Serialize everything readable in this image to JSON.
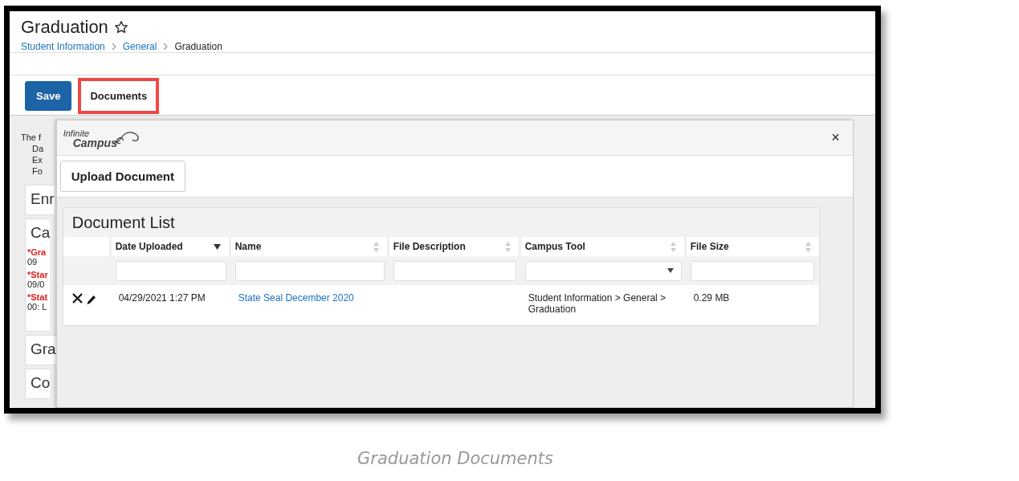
{
  "screenshot": {
    "page_header": {
      "title": "Graduation",
      "favorite": false,
      "breadcrumbs": [
        {
          "label": "Student Information",
          "link": true
        },
        {
          "label": "General",
          "link": true
        },
        {
          "label": "Graduation",
          "link": false
        }
      ]
    },
    "toolbar": [
      {
        "label": "Save",
        "kind": "primary",
        "highlighted": false
      },
      {
        "label": "Documents",
        "kind": "secondary",
        "highlighted": true
      }
    ],
    "background": {
      "intro": [
        "The f",
        "Da",
        "Ex",
        "Fo"
      ],
      "sections": [
        {
          "title": "Enr"
        },
        {
          "title": "Ca",
          "fields": [
            {
              "label": "*Gra",
              "value": "09"
            },
            {
              "label": "*Star",
              "value": "09/0"
            },
            {
              "label": "*Stat",
              "value": "00: L"
            }
          ]
        },
        {
          "title": "Gra"
        },
        {
          "title": "Co"
        }
      ]
    },
    "modal": {
      "logo": {
        "line_1": "Infinite",
        "line_2": "Campus"
      },
      "close": "×",
      "upload_button": "Upload Document",
      "document_list": {
        "title": "Document List",
        "columns": [
          {
            "label": "Date Uploaded",
            "sorted": true,
            "filter": {
              "kind": "text"
            }
          },
          {
            "label": "Name",
            "sorted": false,
            "filter": {
              "kind": "text"
            }
          },
          {
            "label": "File Description",
            "sorted": false,
            "filter": {
              "kind": "text"
            }
          },
          {
            "label": "Campus Tool",
            "sorted": false,
            "filter": {
              "kind": "select"
            }
          },
          {
            "label": "File Size",
            "sorted": false,
            "filter": {
              "kind": "text"
            }
          }
        ],
        "rows": [
          {
            "date_uploaded": "04/29/2021 1:27 PM",
            "name": "State Seal December 2020",
            "campus_tool": "Student Information > General > Graduation",
            "file_size": "0.29 MB"
          }
        ]
      }
    }
  },
  "caption": "Graduation Documents"
}
